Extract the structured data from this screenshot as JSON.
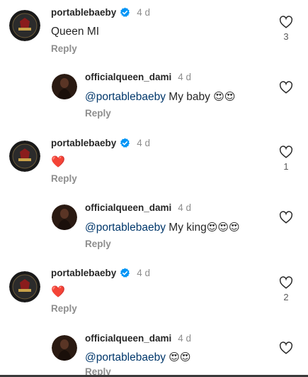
{
  "comments": [
    {
      "username": "portablebaeby",
      "time": "4 d",
      "text": "Queen MI",
      "reply_label": "Reply",
      "likes": "3"
    },
    {
      "username": "officialqueen_dami",
      "time": "4 d",
      "mention": "@portablebaeby",
      "text": " My baby ",
      "emojis": "😍😍",
      "reply_label": "Reply"
    },
    {
      "username": "portablebaeby",
      "time": "4 d",
      "text": "❤️",
      "reply_label": "Reply",
      "likes": "1"
    },
    {
      "username": "officialqueen_dami",
      "time": "4 d",
      "mention": "@portablebaeby",
      "text": " My king",
      "emojis": "😍😍😍",
      "reply_label": "Reply"
    },
    {
      "username": "portablebaeby",
      "time": "4 d",
      "text": "❤️",
      "reply_label": "Reply",
      "likes": "2"
    },
    {
      "username": "officialqueen_dami",
      "time": "4 d",
      "mention": "@portablebaeby",
      "text": " ",
      "emojis": "😍😍",
      "reply_label": "Reply"
    }
  ],
  "icons": {
    "verified": "verified-badge-icon",
    "like": "heart-outline-icon"
  },
  "colors": {
    "mention": "#00376b",
    "verified": "#0095f6",
    "muted": "#8e8e8e"
  }
}
